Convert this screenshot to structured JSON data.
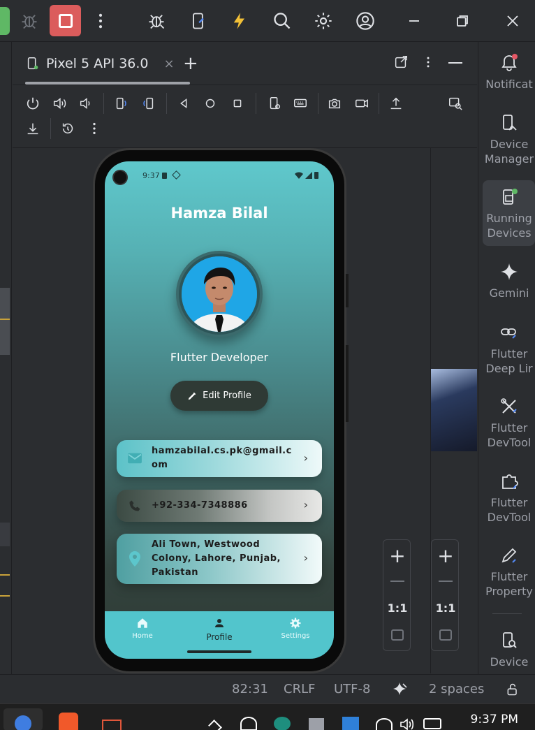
{
  "ide": {
    "tab_title": "Pixel 5 API 36.0",
    "status": {
      "position": "82:31",
      "line_ending": "CRLF",
      "encoding": "UTF-8",
      "indent": "2 spaces"
    },
    "zoom_reset_label": "1:1",
    "sidebar": [
      {
        "label_line1": "Notificat",
        "label_line2": "",
        "icon": "bell-icon"
      },
      {
        "label_line1": "Device",
        "label_line2": "Manager",
        "icon": "device-manager-icon"
      },
      {
        "label_line1": "Running",
        "label_line2": "Devices",
        "icon": "running-devices-icon"
      },
      {
        "label_line1": "Gemini",
        "label_line2": "",
        "icon": "gemini-icon"
      },
      {
        "label_line1": "Flutter",
        "label_line2": "Deep Lir",
        "icon": "deep-link-icon"
      },
      {
        "label_line1": "Flutter",
        "label_line2": "DevTool",
        "icon": "devtools-icon"
      },
      {
        "label_line1": "Flutter",
        "label_line2": "DevTool",
        "icon": "devtools-extension-icon"
      },
      {
        "label_line1": "Flutter",
        "label_line2": "Property",
        "icon": "property-icon"
      },
      {
        "label_line1": "Device",
        "label_line2": "",
        "icon": "device-explorer-icon"
      }
    ],
    "taskbar_time": "9:37 PM"
  },
  "phone": {
    "status_time": "9:37",
    "profile_name": "Hamza Bilal",
    "role": "Flutter Developer",
    "edit_label": "Edit Profile",
    "contacts": [
      {
        "line1": "hamzabilal.cs.pk@gmail.c",
        "line2": "om",
        "line3": "",
        "icon": "email-icon"
      },
      {
        "line1": "+92-334-7348886",
        "line2": "",
        "line3": "",
        "icon": "phone-icon"
      },
      {
        "line1": "Ali Town, Westwood",
        "line2": "Colony, Lahore, Punjab,",
        "line3": "Pakistan",
        "icon": "location-icon"
      }
    ],
    "nav": [
      {
        "label": "Home",
        "icon": "home-icon"
      },
      {
        "label": "Profile",
        "icon": "person-icon"
      },
      {
        "label": "Settings",
        "icon": "settings-icon"
      }
    ]
  },
  "colors": {
    "accent_teal": "#52c5cc",
    "stop_red": "#db5c5c",
    "ide_bg": "#2b2d30"
  }
}
